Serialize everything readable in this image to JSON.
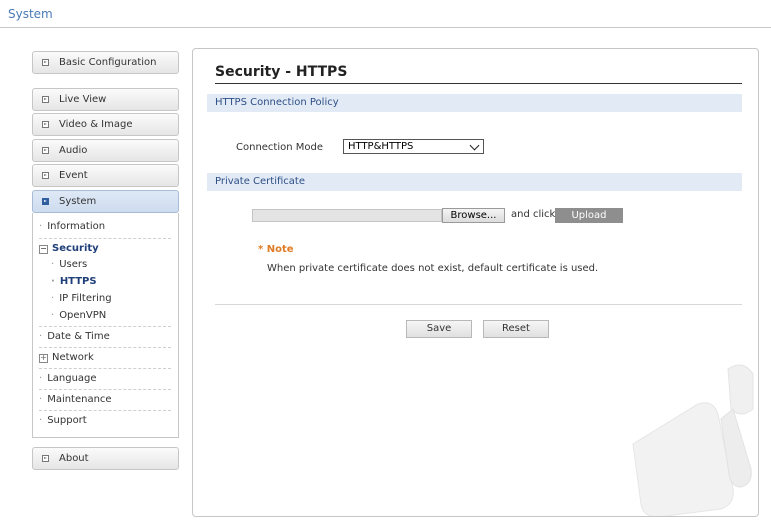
{
  "header": {
    "title": "System"
  },
  "sidebar": {
    "buttons": {
      "basic": "Basic Configuration",
      "live": "Live View",
      "video": "Video & Image",
      "audio": "Audio",
      "event": "Event",
      "system": "System",
      "about": "About"
    },
    "system_items": {
      "information": "Information",
      "security": "Security",
      "users": "Users",
      "https": "HTTPS",
      "ip_filtering": "IP Filtering",
      "openvpn": "OpenVPN",
      "date_time": "Date & Time",
      "network": "Network",
      "language": "Language",
      "maintenance": "Maintenance",
      "support": "Support"
    }
  },
  "main": {
    "title": "Security - HTTPS",
    "policy_section": "HTTPS Connection Policy",
    "connection_mode_label": "Connection Mode",
    "connection_mode_value": "HTTP&HTTPS",
    "cert_section": "Private Certificate",
    "browse_label": "Browse...",
    "and_click": "and click",
    "upload_label": "Upload",
    "note_title": "* Note",
    "note_text": "When private certificate does not exist, default certificate is used.",
    "save_label": "Save",
    "reset_label": "Reset"
  },
  "colors": {
    "accent": "#4a7ab7",
    "note": "#e07c25",
    "section_bg": "#e2eaf6"
  }
}
